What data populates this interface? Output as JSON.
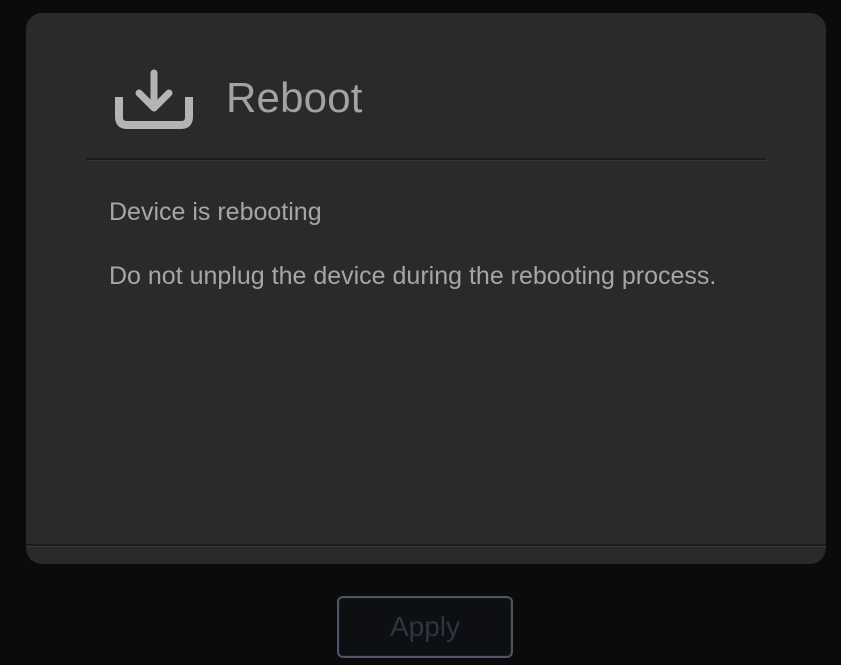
{
  "dialog": {
    "icon": "download-tray-icon",
    "title": "Reboot",
    "status_text": "Device is rebooting",
    "warning_text": "Do not unplug the device during the rebooting process."
  },
  "footer": {
    "apply_label": "Apply",
    "apply_enabled": false
  },
  "colors": {
    "background": "#0b0b0b",
    "dialog_background": "#2a2a2a",
    "text": "#a6a6a6",
    "icon": "#b4b4b4",
    "button_border": "#4b5566",
    "button_text": "#2e3540"
  }
}
